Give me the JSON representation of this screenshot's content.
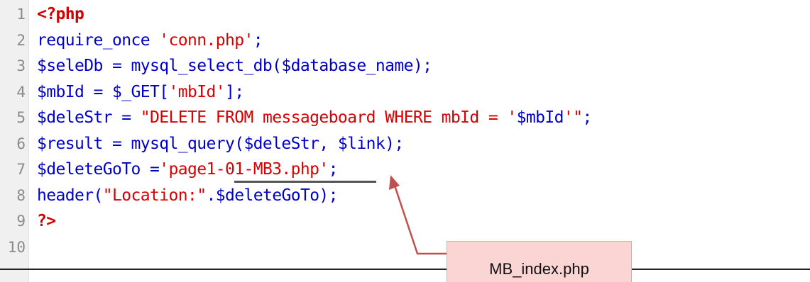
{
  "editor": {
    "lines": [
      {
        "num": "1",
        "parts": [
          {
            "cls": "tag",
            "text": "<?php"
          }
        ]
      },
      {
        "num": "2",
        "parts": [
          {
            "cls": "kw",
            "text": "require_once "
          },
          {
            "cls": "str",
            "text": "'conn.php'"
          },
          {
            "cls": "kw",
            "text": ";"
          }
        ]
      },
      {
        "num": "3",
        "parts": [
          {
            "cls": "kw",
            "text": "$seleDb = mysql_select_db($database_name);"
          }
        ]
      },
      {
        "num": "4",
        "parts": [
          {
            "cls": "kw",
            "text": "$mbId = $_GET["
          },
          {
            "cls": "str",
            "text": "'mbId'"
          },
          {
            "cls": "kw",
            "text": "];"
          }
        ]
      },
      {
        "num": "5",
        "parts": [
          {
            "cls": "kw",
            "text": "$deleStr = "
          },
          {
            "cls": "str",
            "text": "\"DELETE FROM messageboard WHERE mbId = '"
          },
          {
            "cls": "kw",
            "text": "$mbId"
          },
          {
            "cls": "str",
            "text": "'\""
          },
          {
            "cls": "kw",
            "text": ";"
          }
        ]
      },
      {
        "num": "6",
        "parts": [
          {
            "cls": "kw",
            "text": "$result = mysql_query($deleStr, $link);"
          }
        ]
      },
      {
        "num": "7",
        "parts": [
          {
            "cls": "kw",
            "text": "$deleteGoTo ="
          },
          {
            "cls": "str",
            "text": "'page1-01-MB3.php'"
          },
          {
            "cls": "kw",
            "text": ";"
          }
        ]
      },
      {
        "num": "8",
        "parts": [
          {
            "cls": "kw",
            "text": "header("
          },
          {
            "cls": "str",
            "text": "\"Location:\""
          },
          {
            "cls": "kw",
            "text": ".$deleteGoTo);"
          }
        ]
      },
      {
        "num": "9",
        "parts": [
          {
            "cls": "tag",
            "text": "?>"
          }
        ]
      },
      {
        "num": "10",
        "parts": []
      }
    ]
  },
  "callout": {
    "text": "MB_index.php"
  },
  "colors": {
    "keyword": "#0000c8",
    "string": "#d80000",
    "php_tag": "#d40000",
    "gutter_bg": "#f0f0f0",
    "callout_bg": "#fbd4d4",
    "arrow": "#c0504d"
  }
}
